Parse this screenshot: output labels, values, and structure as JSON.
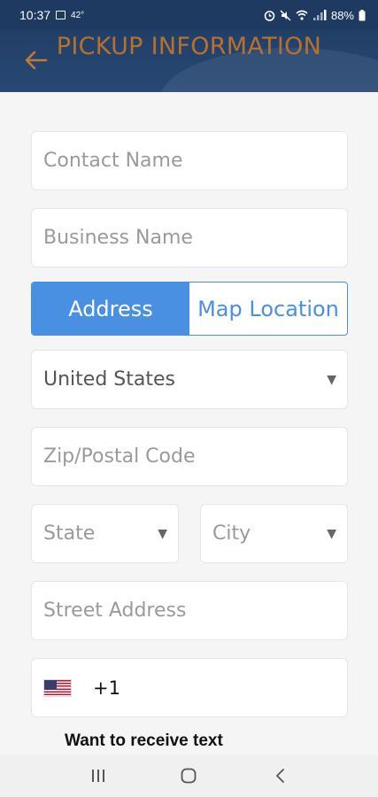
{
  "status_bar": {
    "time": "10:37",
    "temperature": "42°",
    "battery": "88%",
    "icons": [
      "gallery-icon",
      "alarm-icon",
      "mute-icon",
      "wifi-icon",
      "signal-icon",
      "battery-icon"
    ]
  },
  "header": {
    "title": "PICKUP INFORMATION",
    "back_icon": "arrow-left-icon",
    "background": "#243f68",
    "title_color": "#b5722e"
  },
  "form": {
    "contact_name_placeholder": "Contact Name",
    "business_name_placeholder": "Business Name",
    "location_toggle": {
      "options": [
        "Address",
        "Map Location"
      ],
      "selected": "Address",
      "accent": "#4a90e2"
    },
    "country": {
      "value": "United States"
    },
    "zip_placeholder": "Zip/Postal Code",
    "state": {
      "placeholder": "State"
    },
    "city": {
      "placeholder": "City"
    },
    "street_address_placeholder": "Street Address",
    "phone": {
      "flag_icon": "us-flag-icon",
      "country_code": "+1"
    },
    "sms_prompt": "Want to receive text"
  },
  "nav_bar": {
    "buttons": [
      "recent-apps-icon",
      "home-icon",
      "back-icon"
    ]
  }
}
